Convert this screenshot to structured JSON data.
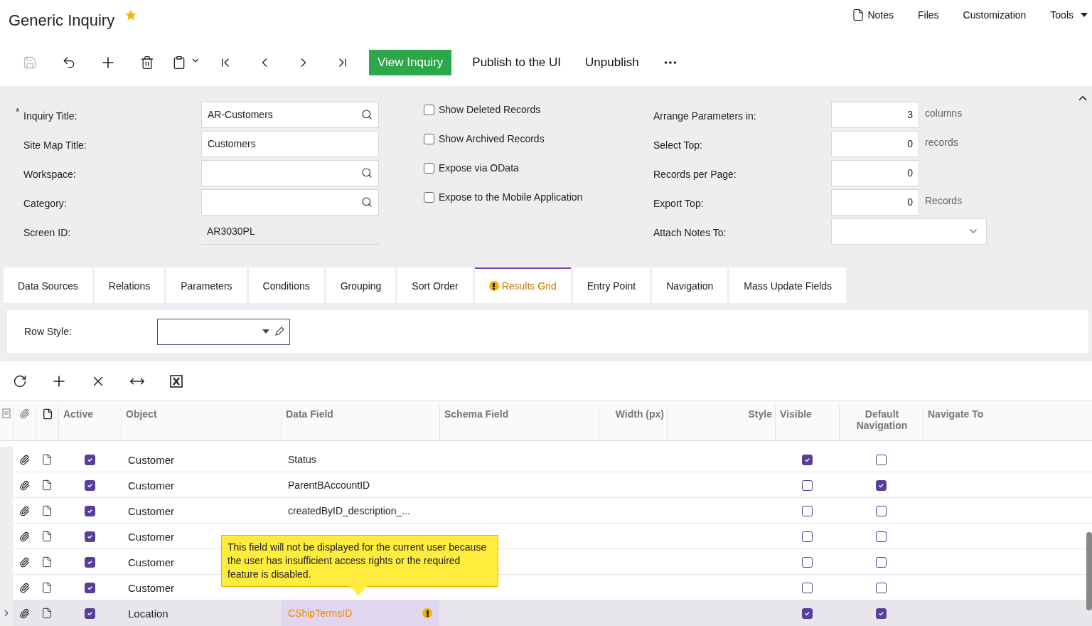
{
  "header": {
    "title": "Generic Inquiry",
    "favorite": true,
    "links": [
      {
        "label": "Notes",
        "kind": "notes"
      },
      {
        "label": "Files",
        "kind": "plain"
      },
      {
        "label": "Customization",
        "kind": "plain"
      },
      {
        "label": "Tools",
        "kind": "menu"
      }
    ]
  },
  "toolbar": {
    "icons": [
      {
        "kind": "save",
        "disabled": true
      },
      {
        "kind": "undo",
        "disabled": false
      },
      {
        "kind": "add",
        "disabled": false
      },
      {
        "kind": "delete",
        "disabled": false
      },
      {
        "kind": "clipboard",
        "disabled": false
      },
      {
        "kind": "first",
        "disabled": false
      },
      {
        "kind": "prev",
        "disabled": false
      },
      {
        "kind": "next",
        "disabled": false
      },
      {
        "kind": "last",
        "disabled": false
      }
    ],
    "primary": "View Inquiry",
    "actions": [
      "Publish to the UI",
      "Unpublish"
    ]
  },
  "form": {
    "fields": [
      {
        "mark": "*",
        "label": "Inquiry Title:",
        "value": "AR-Customers",
        "kind": "lookup"
      },
      {
        "label": "Site Map Title:",
        "value": "Customers",
        "kind": "text"
      },
      {
        "label": "Workspace:",
        "kind": "lookup"
      },
      {
        "label": "Category:",
        "kind": "lookup"
      },
      {
        "label": "Screen ID:",
        "value": "AR3030PL",
        "kind": "readonly"
      }
    ],
    "checkboxes": [
      {
        "label": "Show Deleted Records",
        "checked": false
      },
      {
        "label": "Show Archived Records",
        "checked": false
      },
      {
        "label": "Expose via OData",
        "checked": false
      },
      {
        "label": "Expose to the Mobile Application",
        "checked": false
      }
    ],
    "settings": [
      {
        "label": "Arrange Parameters in:",
        "value": "3",
        "unit": "columns",
        "kind": "number"
      },
      {
        "label": "Select Top:",
        "value": "0",
        "unit": "records",
        "kind": "number"
      },
      {
        "label": "Records per Page:",
        "value": "0",
        "kind": "number"
      },
      {
        "label": "Export Top:",
        "value": "0",
        "unit": "Records",
        "kind": "number"
      },
      {
        "label": "Attach Notes To:",
        "kind": "select"
      }
    ]
  },
  "tabs": [
    {
      "label": "Data Sources",
      "selected": false,
      "warning": false
    },
    {
      "label": "Relations",
      "selected": false,
      "warning": false
    },
    {
      "label": "Parameters",
      "selected": false,
      "warning": false
    },
    {
      "label": "Conditions",
      "selected": false,
      "warning": false
    },
    {
      "label": "Grouping",
      "selected": false,
      "warning": false
    },
    {
      "label": "Sort Order",
      "selected": false,
      "warning": false
    },
    {
      "label": "Results Grid",
      "selected": true,
      "warning": true
    },
    {
      "label": "Entry Point",
      "selected": false,
      "warning": false
    },
    {
      "label": "Navigation",
      "selected": false,
      "warning": false
    },
    {
      "label": "Mass Update Fields",
      "selected": false,
      "warning": false
    }
  ],
  "row_style": {
    "label": "Row Style:"
  },
  "grid": {
    "columns": [
      "Active",
      "Object",
      "Data Field",
      "Schema Field",
      "Width (px)",
      "Style",
      "Visible",
      "Default Navigation",
      "Navigate To"
    ],
    "rows": [
      {
        "selected": false,
        "active": true,
        "object": "Customer",
        "data_field": "Status",
        "visible": true,
        "default_navigation": false,
        "warning": false
      },
      {
        "selected": false,
        "active": true,
        "object": "Customer",
        "data_field": "ParentBAccountID",
        "visible": false,
        "default_navigation": true,
        "warning": false
      },
      {
        "selected": false,
        "active": true,
        "object": "Customer",
        "data_field": "createdByID_description_...",
        "visible": false,
        "default_navigation": false,
        "warning": false
      },
      {
        "selected": false,
        "active": true,
        "object": "Customer",
        "visible": false,
        "default_navigation": false,
        "warning": false
      },
      {
        "selected": false,
        "active": true,
        "object": "Customer",
        "visible": false,
        "default_navigation": false,
        "warning": false
      },
      {
        "selected": false,
        "active": true,
        "object": "Customer",
        "visible": false,
        "default_navigation": false,
        "warning": false
      },
      {
        "selected": true,
        "active": true,
        "object": "Location",
        "data_field": "CShipTermsID",
        "visible": true,
        "default_navigation": true,
        "warning": true
      }
    ]
  },
  "tooltip": {
    "text": "This field will not be displayed for the current user because the user has insufficient access rights or the required feature is disabled."
  }
}
